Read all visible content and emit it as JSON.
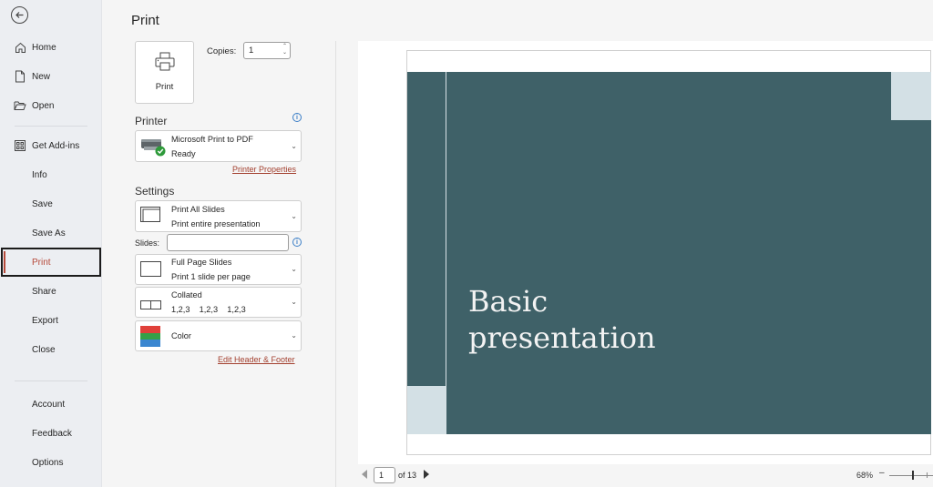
{
  "sidebar": {
    "back_label": "Back",
    "items": [
      {
        "label": "Home",
        "icon": "home-icon"
      },
      {
        "label": "New",
        "icon": "new-document-icon"
      },
      {
        "label": "Open",
        "icon": "folder-open-icon"
      },
      {
        "label": "Get Add-ins",
        "icon": "add-ins-grid-icon"
      },
      {
        "label": "Info"
      },
      {
        "label": "Save"
      },
      {
        "label": "Save As"
      },
      {
        "label": "Print",
        "active": true
      },
      {
        "label": "Share"
      },
      {
        "label": "Export"
      },
      {
        "label": "Close"
      },
      {
        "label": "Account"
      },
      {
        "label": "Feedback"
      },
      {
        "label": "Options"
      }
    ]
  },
  "print_panel": {
    "title": "Print",
    "print_button_label": "Print",
    "copies_label": "Copies:",
    "copies_value": "1",
    "printer_heading": "Printer",
    "printer": {
      "name": "Microsoft Print to PDF",
      "status": "Ready"
    },
    "printer_properties_link": "Printer Properties",
    "settings_heading": "Settings",
    "slides_range": {
      "line1": "Print All Slides",
      "line2": "Print entire presentation"
    },
    "slides_label": "Slides:",
    "slides_value": "",
    "layout": {
      "line1": "Full Page Slides",
      "line2": "Print 1 slide per page"
    },
    "collation": {
      "line1": "Collated",
      "line2": "1,2,3    1,2,3    1,2,3"
    },
    "color": {
      "line1": "Color"
    },
    "edit_header_footer_link": "Edit Header & Footer"
  },
  "preview": {
    "slide_title_line1": "Basic",
    "slide_title_line2": "presentation",
    "slide_bg_color": "#3f6168",
    "accent_block_color": "#d3e0e5"
  },
  "pager": {
    "current_page": "1",
    "of_text": "of 13",
    "zoom_percent": "68%",
    "zoom_value": 68
  },
  "colors": {
    "accent": "#b6493a",
    "link": "#a3402f",
    "info": "#3a7ec7"
  }
}
